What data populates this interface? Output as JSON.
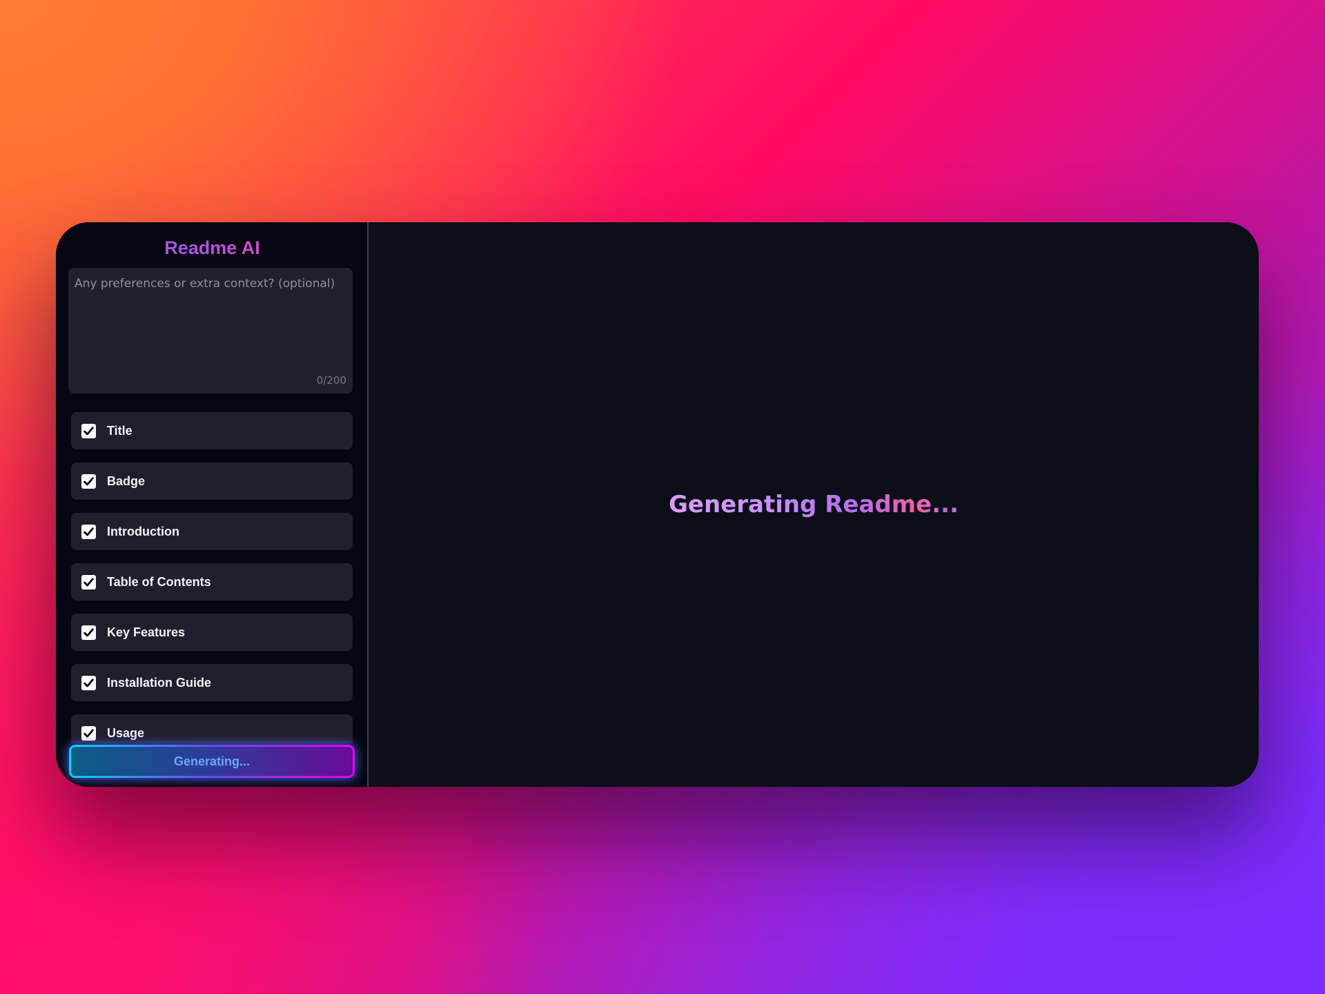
{
  "app": {
    "title": "Readme AI"
  },
  "context": {
    "placeholder": "Any preferences or extra context? (optional)",
    "value": "",
    "char_count": "0/200"
  },
  "sections": [
    {
      "label": "Title",
      "checked": true
    },
    {
      "label": "Badge",
      "checked": true
    },
    {
      "label": "Introduction",
      "checked": true
    },
    {
      "label": "Table of Contents",
      "checked": true
    },
    {
      "label": "Key Features",
      "checked": true
    },
    {
      "label": "Installation Guide",
      "checked": true
    },
    {
      "label": "Usage",
      "checked": true
    }
  ],
  "generate_button": {
    "label": "Generating..."
  },
  "main": {
    "status": "Generating Readme..."
  },
  "colors": {
    "window_bg": "#0c0f18",
    "sidebar_bg": "#050813",
    "card_bg": "#1e202c",
    "title_gradient_start": "#6a63ff",
    "title_gradient_end": "#ff3f86",
    "button_border_start": "#0fd0ff",
    "button_border_end": "#e600ff",
    "status_gradient_start": "#dc9dff",
    "status_gradient_end": "#ef5fa6"
  },
  "icons": {
    "checkbox": "check-icon"
  }
}
